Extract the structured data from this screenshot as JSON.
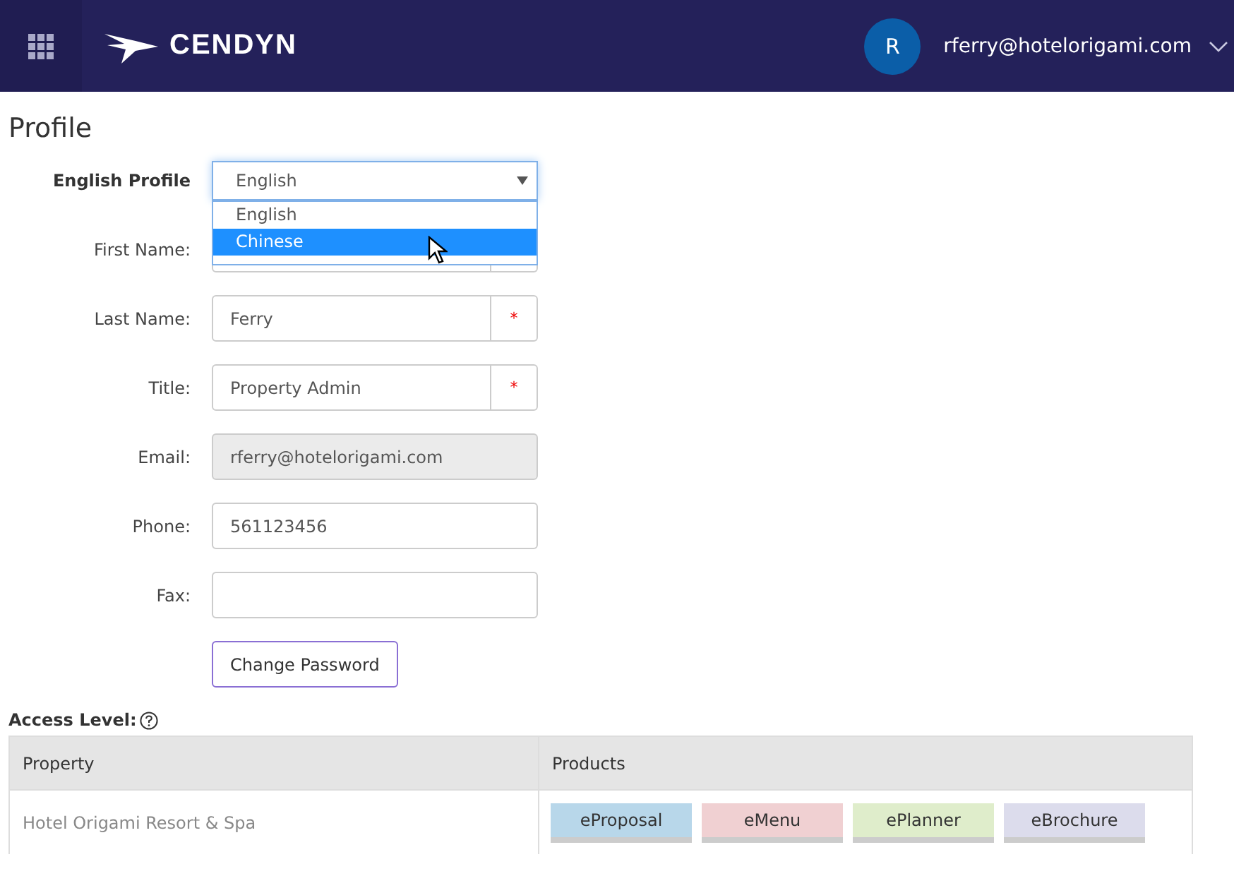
{
  "header": {
    "logo_text": "CENDYN",
    "avatar_initial": "R",
    "user_email": "rferry@hotelorigami.com"
  },
  "page_title": "Profile",
  "profile_select": {
    "label": "English Profile",
    "value": "English",
    "expanded": true,
    "options": [
      {
        "label": "English",
        "highlighted": false
      },
      {
        "label": "Chinese",
        "highlighted": true
      }
    ]
  },
  "fields": [
    {
      "label": "First Name:",
      "kind": "text",
      "required": true
    },
    {
      "label": "Last Name:",
      "kind": "text",
      "value": "Ferry",
      "required": true
    },
    {
      "label": "Title:",
      "kind": "text",
      "value": "Property Admin",
      "required": true
    },
    {
      "label": "Email:",
      "kind": "readonly",
      "value": "rferry@hotelorigami.com",
      "required": false
    },
    {
      "label": "Phone:",
      "kind": "text",
      "value": "561123456",
      "required": false
    },
    {
      "label": "Fax:",
      "kind": "text",
      "required": false
    }
  ],
  "required_mark": "*",
  "change_password_button": "Change Password",
  "access_level": {
    "label": "Access Level:",
    "columns": [
      "Property",
      "Products"
    ],
    "rows": [
      {
        "property": "Hotel Origami Resort & Spa",
        "products": [
          {
            "label": "eProposal",
            "color": "#b8d7ea"
          },
          {
            "label": "eMenu",
            "color": "#f0d0d2"
          },
          {
            "label": "ePlanner",
            "color": "#dfedcb"
          },
          {
            "label": "eBrochure",
            "color": "#dcdcec"
          }
        ]
      }
    ]
  }
}
